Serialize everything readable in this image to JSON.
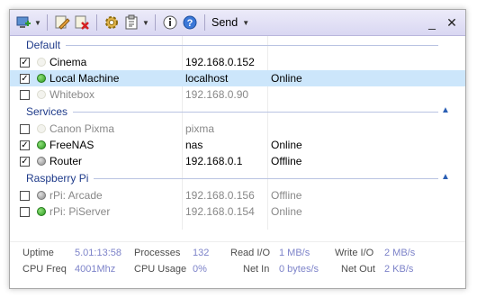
{
  "toolbar": {
    "send_label": "Send",
    "colors": {
      "gradient_top": "#ecebf9",
      "gradient_bottom": "#d9d7f2"
    },
    "icons": [
      "add-computer-icon",
      "edit-icon",
      "delete-icon",
      "settings-icon",
      "clipboard-icon",
      "info-icon",
      "help-icon"
    ],
    "window_controls": {
      "minimize": "_",
      "close": "✕"
    }
  },
  "groups": [
    {
      "label": "Default",
      "collapse_icon": "",
      "items": [
        {
          "name": "Cinema",
          "address": "192.168.0.152",
          "status": "",
          "checked": true,
          "state": "none",
          "selected": false,
          "disabled": false
        },
        {
          "name": "Local Machine",
          "address": "localhost",
          "status": "Online",
          "checked": true,
          "state": "online",
          "selected": true,
          "disabled": false
        },
        {
          "name": "Whitebox",
          "address": "192.168.0.90",
          "status": "",
          "checked": false,
          "state": "none",
          "selected": false,
          "disabled": true
        }
      ]
    },
    {
      "label": "Services",
      "collapse_icon": "▲",
      "items": [
        {
          "name": "Canon Pixma",
          "address": "pixma",
          "status": "",
          "checked": false,
          "state": "none",
          "selected": false,
          "disabled": true
        },
        {
          "name": "FreeNAS",
          "address": "nas",
          "status": "Online",
          "checked": true,
          "state": "online",
          "selected": false,
          "disabled": false
        },
        {
          "name": "Router",
          "address": "192.168.0.1",
          "status": "Offline",
          "checked": true,
          "state": "offline",
          "selected": false,
          "disabled": false
        }
      ]
    },
    {
      "label": "Raspberry Pi",
      "collapse_icon": "▲",
      "items": [
        {
          "name": "rPi: Arcade",
          "address": "192.168.0.156",
          "status": "Offline",
          "checked": false,
          "state": "offline",
          "selected": false,
          "disabled": true
        },
        {
          "name": "rPi: PiServer",
          "address": "192.168.0.154",
          "status": "Online",
          "checked": false,
          "state": "online",
          "selected": false,
          "disabled": true
        }
      ]
    }
  ],
  "stats": {
    "uptime_label": "Uptime",
    "uptime_value": "5.01:13:58",
    "processes_label": "Processes",
    "processes_value": "132",
    "readio_label": "Read I/O",
    "readio_value": "1 MB/s",
    "writeio_label": "Write I/O",
    "writeio_value": "2 MB/s",
    "cpufreq_label": "CPU Freq",
    "cpufreq_value": "4001Mhz",
    "cpuusage_label": "CPU Usage",
    "cpuusage_value": "0%",
    "netin_label": "Net In",
    "netin_value": "0 bytes/s",
    "netout_label": "Net Out",
    "netout_value": "2 KB/s"
  }
}
